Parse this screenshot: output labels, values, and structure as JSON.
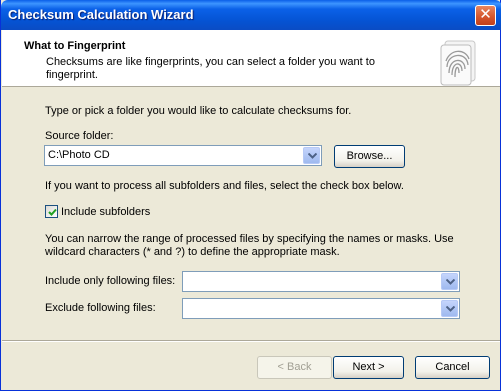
{
  "window": {
    "title": "Checksum Calculation Wizard",
    "close_glyph": "✕"
  },
  "header": {
    "title": "What to Fingerprint",
    "subtitle": "Checksums are like fingerprints, you can select a folder you want to fingerprint.",
    "icon": "fingerprint-icon"
  },
  "main": {
    "intro": "Type or pick a folder you would like to calculate checksums for.",
    "source_label": "Source folder:",
    "source_value": "C:\\Photo CD",
    "browse_label": "Browse...",
    "subfolder_hint": "If you want to process all subfolders and files, select the check box below.",
    "include_subfolders_label": "Include subfolders",
    "include_subfolders_checked": true,
    "mask_hint": "You can narrow the range of processed files by specifying the names or masks. Use wildcard characters (* and ?) to define the appropriate mask.",
    "include_label": "Include only following files:",
    "include_value": "",
    "exclude_label": "Exclude following files:",
    "exclude_value": ""
  },
  "footer": {
    "back_label": "< Back",
    "next_label": "Next >",
    "cancel_label": "Cancel"
  },
  "colors": {
    "titlebar": "#0553d3",
    "dialog_bg": "#ece9d8",
    "accent_border": "#003c74"
  }
}
